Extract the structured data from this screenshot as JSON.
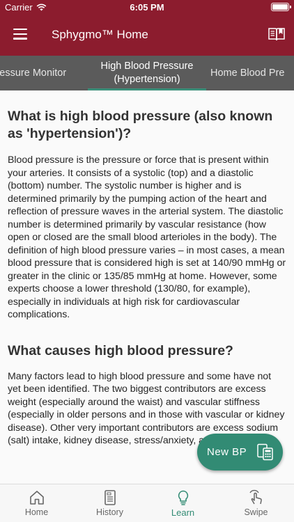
{
  "status_bar": {
    "carrier": "Carrier",
    "time": "6:05 PM"
  },
  "app_bar": {
    "title": "Sphygmo™ Home"
  },
  "tabs": [
    {
      "label": "Blood Pressure Monitor"
    },
    {
      "label": "High Blood Pressure (Hypertension)"
    },
    {
      "label": "Home Blood Pressure"
    }
  ],
  "tab_lines": {
    "tab1": "Pressure Monitor",
    "tab2_line1": "High Blood Pressure",
    "tab2_line2": "(Hypertension)",
    "tab3": "Home Blood Pre"
  },
  "article": {
    "heading_1": "What is high blood pressure (also known as 'hypertension')?",
    "paragraph_1": "Blood pressure is the pressure or force that is present within your arteries. It consists of a systolic (top) and a diastolic (bottom) number. The systolic number is higher and is determined primarily by the pumping action of the heart and reflection of pressure waves in the arterial system. The diastolic number is determined primarily by vascular resistance (how open or closed are the small blood arterioles in the body). The definition of high blood pressure varies – in most cases, a mean blood pressure that is considered high is set at 140/90 mmHg or greater in the clinic or 135/85 mmHg at home. However, some experts choose a lower threshold (130/80, for example), especially in individuals at high risk for cardiovascular complications.",
    "heading_2": "What causes high blood pressure?",
    "paragraph_2": "Many factors lead to high blood pressure and some have not yet been identified. The two biggest contributors are excess weight (especially around the waist) and vascular stiffness (especially in older persons and in those with vascular or kidney disease). Other very important contributors are excess sodium (salt) intake, kidney disease, stress/anxiety, and genetics."
  },
  "fab": {
    "label": "New BP",
    "icon": "calculator-document-icon"
  },
  "bottom_nav": [
    {
      "label": "Home",
      "icon": "home-icon"
    },
    {
      "label": "History",
      "icon": "history-document-icon"
    },
    {
      "label": "Learn",
      "icon": "lightbulb-icon",
      "active": true
    },
    {
      "label": "Swipe",
      "icon": "swipe-hand-icon"
    }
  ],
  "colors": {
    "primary": "#8c1c2e",
    "accent": "#328b74",
    "tab_bar": "#5b5b5b"
  }
}
